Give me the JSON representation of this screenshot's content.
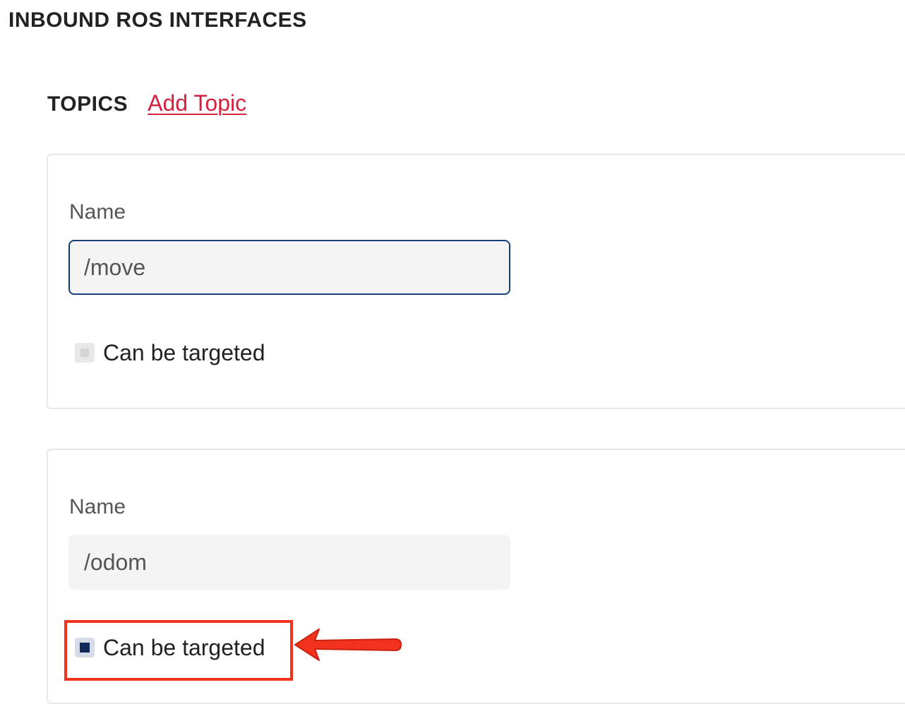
{
  "section": {
    "title": "INBOUND ROS INTERFACES"
  },
  "topics": {
    "title": "TOPICS",
    "add_label": "Add Topic",
    "items": [
      {
        "name_label": "Name",
        "name_value": "/move",
        "checkbox_label": "Can be targeted",
        "checked": false
      },
      {
        "name_label": "Name",
        "name_value": "/odom",
        "checkbox_label": "Can be targeted",
        "checked": true
      }
    ]
  },
  "colors": {
    "link": "#d4213d",
    "focus_border": "#153e75",
    "checkbox_checked": "#10295a",
    "annotation": "#f3321e"
  },
  "icons": {
    "annotation_arrow": "arrow-left-icon"
  }
}
